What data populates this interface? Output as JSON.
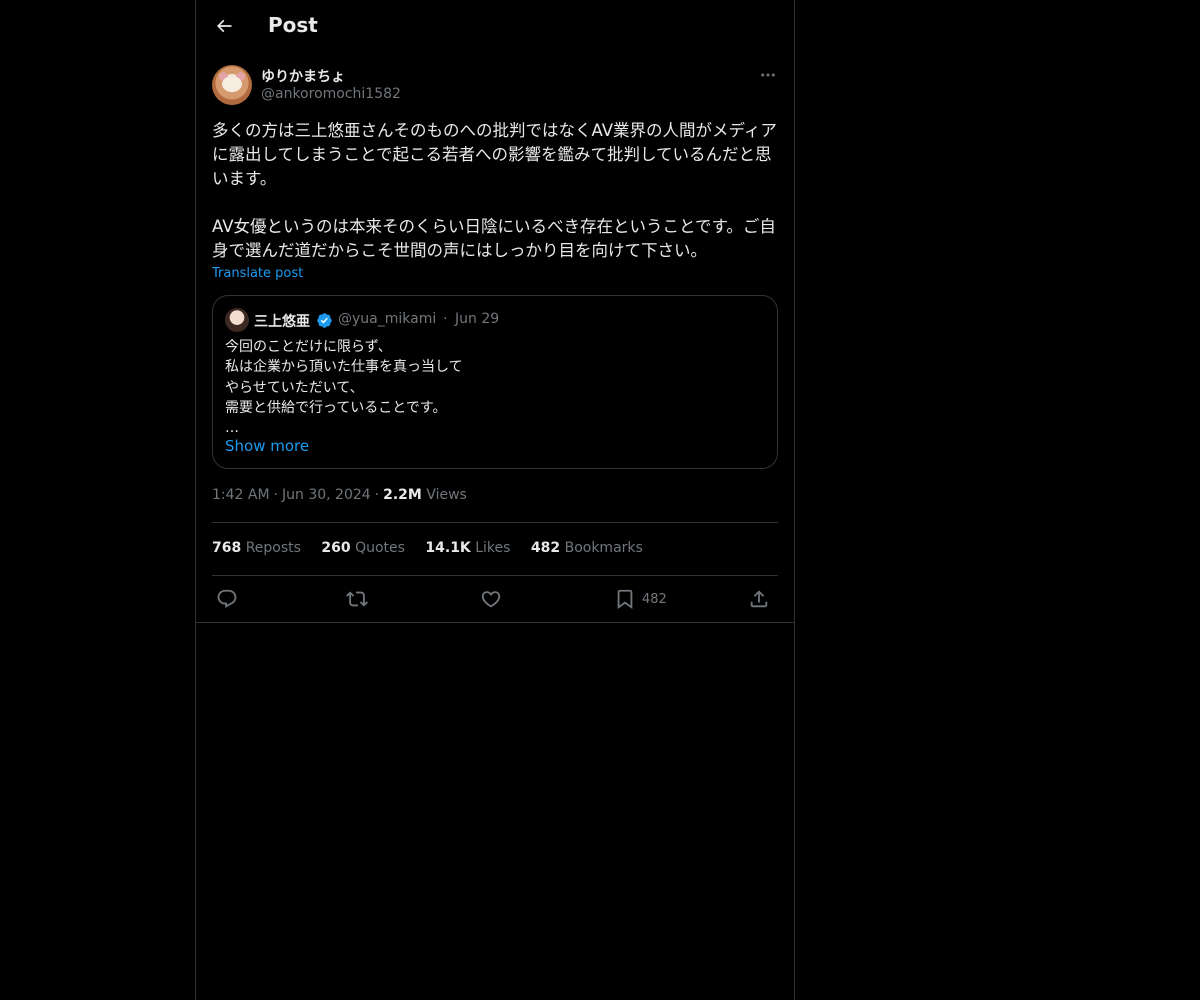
{
  "header": {
    "title": "Post"
  },
  "author": {
    "display_name": "ゆりかまちょ",
    "handle": "@ankoromochi1582"
  },
  "post": {
    "text": "多くの方は三上悠亜さんそのものへの批判ではなくAV業界の人間がメディアに露出してしまうことで起こる若者への影響を鑑みて批判しているんだと思います。\n\nAV女優というのは本来そのくらい日陰にいるべき存在ということです。ご自身で選んだ道だからこそ世間の声にはしっかり目を向けて下さい。",
    "translate_label": "Translate post"
  },
  "quote": {
    "name": "三上悠亜",
    "handle": "@yua_mikami",
    "separator": "·",
    "date": "Jun 29",
    "lines": [
      "今回のことだけに限らず、",
      "私は企業から頂いた仕事を真っ当して",
      "やらせていただいて、",
      "需要と供給で行っていることです。",
      "…"
    ],
    "show_more": "Show more"
  },
  "meta": {
    "time": "1:42 AM",
    "separator": "·",
    "date": "Jun 30, 2024",
    "views_count": "2.2M",
    "views_label": "Views"
  },
  "stats": {
    "reposts_count": "768",
    "reposts_label": "Reposts",
    "quotes_count": "260",
    "quotes_label": "Quotes",
    "likes_count": "14.1K",
    "likes_label": "Likes",
    "bookmarks_count": "482",
    "bookmarks_label": "Bookmarks"
  },
  "actions": {
    "bookmark_count": "482"
  },
  "colors": {
    "background": "#000000",
    "text": "#e7e9ea",
    "secondary": "#71767b",
    "accent": "#1d9bf0",
    "border": "#2f3336"
  },
  "icons": [
    "back-arrow-icon",
    "more-icon",
    "verified-badge-icon",
    "reply-icon",
    "repost-icon",
    "like-icon",
    "bookmark-icon",
    "share-icon"
  ]
}
